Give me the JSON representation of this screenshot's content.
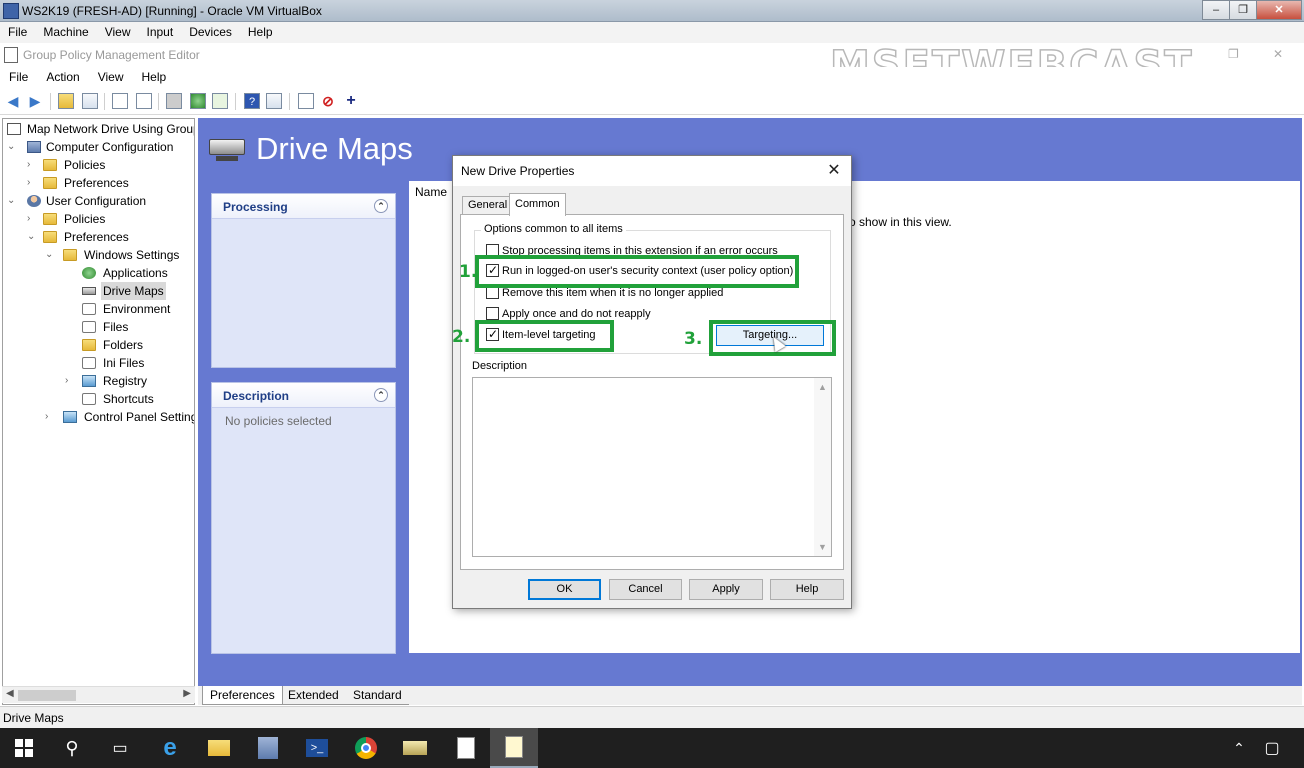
{
  "vbox": {
    "title": "WS2K19 (FRESH-AD) [Running] - Oracle VM VirtualBox",
    "menu": [
      "File",
      "Machine",
      "View",
      "Input",
      "Devices",
      "Help"
    ],
    "controls": {
      "min": "–",
      "max": "❐",
      "close": "✕"
    }
  },
  "gpme": {
    "title": "Group Policy Management Editor",
    "watermark": "MSFTWEBCAST",
    "menu": [
      "File",
      "Action",
      "View",
      "Help"
    ],
    "window_controls": {
      "max": "❐",
      "close": "✕"
    }
  },
  "tree": {
    "root": "Map Network Drive Using Group",
    "computer_configuration": "Computer Configuration",
    "cc_policies": "Policies",
    "cc_preferences": "Preferences",
    "user_configuration": "User Configuration",
    "uc_policies": "Policies",
    "uc_preferences": "Preferences",
    "windows_settings": "Windows Settings",
    "applications": "Applications",
    "drive_maps": "Drive Maps",
    "environment": "Environment",
    "files": "Files",
    "folders": "Folders",
    "ini_files": "Ini Files",
    "registry": "Registry",
    "shortcuts": "Shortcuts",
    "control_panel": "Control Panel Setting"
  },
  "main": {
    "heading": "Drive Maps",
    "processing_title": "Processing",
    "description_title": "Description",
    "description_body": "No policies selected",
    "name_column": "Name",
    "empty_message": "o show in this view."
  },
  "bottom_tabs": [
    "Preferences",
    "Extended",
    "Standard"
  ],
  "status": "Drive Maps",
  "dialog": {
    "title": "New Drive Properties",
    "tabs": [
      "General",
      "Common"
    ],
    "group_title": "Options common to all items",
    "options": [
      {
        "label": "Stop processing items in this extension if an error occurs",
        "checked": false
      },
      {
        "label": "Run in logged-on user's security context (user policy option)",
        "checked": true
      },
      {
        "label": "Remove this item when it is no longer applied",
        "checked": false
      },
      {
        "label": "Apply once and do not reapply",
        "checked": false
      },
      {
        "label": "Item-level targeting",
        "checked": true
      }
    ],
    "targeting_button": "Targeting...",
    "description_label": "Description",
    "buttons": {
      "ok": "OK",
      "cancel": "Cancel",
      "apply": "Apply",
      "help": "Help"
    }
  },
  "annotations": [
    "1.",
    "2.",
    "3."
  ],
  "colors": {
    "highlight": "#21a13a",
    "panel_bg": "#6679d1",
    "heading": "#ffffff"
  },
  "taskbar": {
    "icons": [
      "windows-start-icon",
      "search-icon",
      "task-view-icon",
      "internet-explorer-icon",
      "file-explorer-icon",
      "server-manager-icon",
      "powershell-icon",
      "chrome-icon",
      "gpmc-icon",
      "notepad-icon",
      "gpme-icon"
    ]
  }
}
